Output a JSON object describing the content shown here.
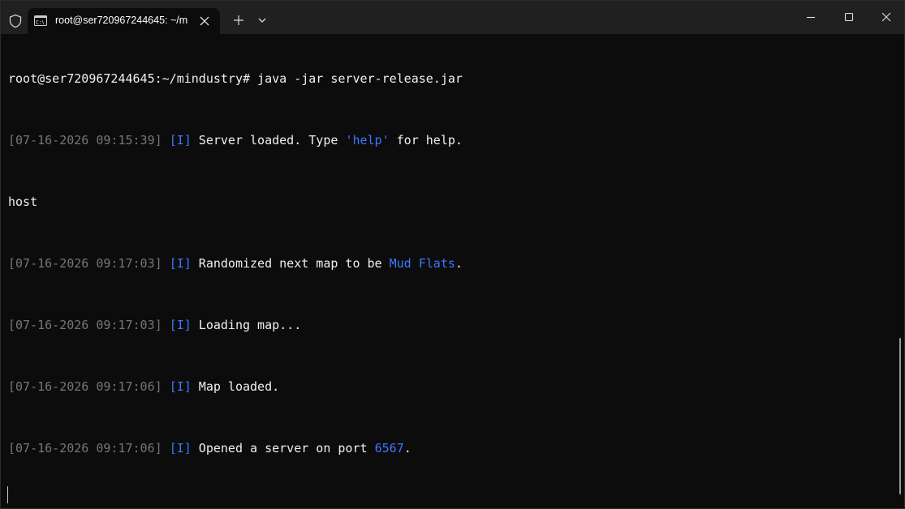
{
  "window": {
    "tab_title": "root@ser720967244645: ~/m"
  },
  "terminal": {
    "prompt_line": "root@ser720967244645:~/mindustry# java -jar server-release.jar",
    "lines": [
      {
        "ts": "[07-16-2026 09:15:39]",
        "tag": "[I]",
        "pre": " Server loaded. Type ",
        "hl": "'help'",
        "post": " for help."
      },
      {
        "plain": "host"
      },
      {
        "ts": "[07-16-2026 09:17:03]",
        "tag": "[I]",
        "pre": " Randomized next map to be ",
        "hl": "Mud Flats",
        "post": "."
      },
      {
        "ts": "[07-16-2026 09:17:03]",
        "tag": "[I]",
        "pre": " Loading map...",
        "hl": "",
        "post": ""
      },
      {
        "ts": "[07-16-2026 09:17:06]",
        "tag": "[I]",
        "pre": " Map loaded.",
        "hl": "",
        "post": ""
      },
      {
        "ts": "[07-16-2026 09:17:06]",
        "tag": "[I]",
        "pre": " Opened a server on port ",
        "hl": "6567",
        "post": "."
      }
    ]
  },
  "icons": {
    "shield": "shield-icon",
    "tab": "terminal-icon",
    "close": "close-icon",
    "new_tab": "plus-icon",
    "dropdown": "chevron-down-icon",
    "minimize": "minimize-icon",
    "maximize": "maximize-icon",
    "window_close": "close-icon"
  },
  "colors": {
    "background": "#0c0c0c",
    "titlebar": "#202020",
    "foreground": "#f0f0f0",
    "timestamp": "#767676",
    "accent_blue": "#3b78ff"
  }
}
